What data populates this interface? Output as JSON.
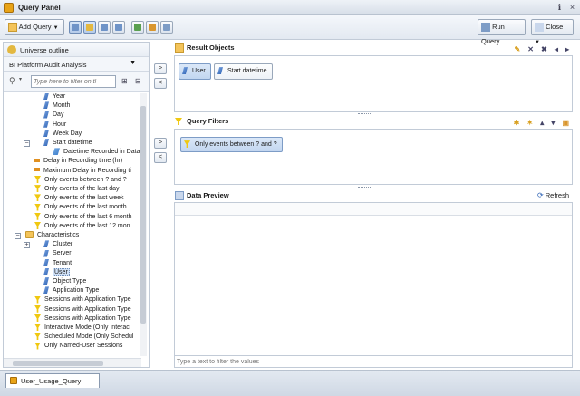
{
  "window": {
    "title": "Query Panel"
  },
  "toolbar": {
    "add_query": "Add Query",
    "run_query": "Run Query",
    "close": "Close"
  },
  "left_panel": {
    "header": "Universe outline",
    "universe": "BI Platform Audit Analysis",
    "filter_placeholder": "Type here to filter on tl",
    "tree": [
      {
        "label": "Year",
        "icon": "dimension"
      },
      {
        "label": "Month",
        "icon": "dimension"
      },
      {
        "label": "Day",
        "icon": "dimension"
      },
      {
        "label": "Hour",
        "icon": "dimension"
      },
      {
        "label": "Week Day",
        "icon": "dimension"
      },
      {
        "label": "Start datetime",
        "icon": "dimension"
      },
      {
        "label": "Datetime Recorded in Data",
        "icon": "attribute"
      },
      {
        "label": "Delay in Recording time (hr)",
        "icon": "measure"
      },
      {
        "label": "Maximum Delay in Recording ti",
        "icon": "measure"
      },
      {
        "label": "Only events between ? and ?",
        "icon": "filter"
      },
      {
        "label": "Only events of the last day",
        "icon": "filter"
      },
      {
        "label": "Only events of the last week",
        "icon": "filter"
      },
      {
        "label": "Only events of the last month",
        "icon": "filter"
      },
      {
        "label": "Only events of the last 6 month",
        "icon": "filter"
      },
      {
        "label": "Only events of the last 12 mon",
        "icon": "filter"
      },
      {
        "label": "Characteristics",
        "icon": "folder"
      },
      {
        "label": "Cluster",
        "icon": "dimension"
      },
      {
        "label": "Server",
        "icon": "dimension"
      },
      {
        "label": "Tenant",
        "icon": "dimension"
      },
      {
        "label": "User",
        "icon": "dimension"
      },
      {
        "label": "Object Type",
        "icon": "dimension"
      },
      {
        "label": "Application Type",
        "icon": "dimension"
      },
      {
        "label": "Sessions with Application Type",
        "icon": "filter"
      },
      {
        "label": "Sessions with Application Type",
        "icon": "filter"
      },
      {
        "label": "Sessions with Application Type",
        "icon": "filter"
      },
      {
        "label": "Interactive Mode (Only Interac",
        "icon": "filter"
      },
      {
        "label": "Scheduled Mode (Only Schedul",
        "icon": "filter"
      },
      {
        "label": "Only Named-User Sessions",
        "icon": "filter"
      }
    ]
  },
  "result_objects": {
    "header": "Result Objects",
    "items": [
      "User",
      "Start datetime"
    ]
  },
  "query_filters": {
    "header": "Query Filters",
    "items": [
      "Only events between ? and ?"
    ]
  },
  "data_preview": {
    "header": "Data Preview",
    "refresh": "Refresh",
    "filter_placeholder": "Type a text to filter the values"
  },
  "status": {
    "tab": "User_Usage_Query"
  },
  "colors": {
    "accent": "#2d62b4",
    "filter_icon": "#f0c810",
    "measure_icon": "#e09020",
    "folder_icon": "#f4c45a"
  }
}
